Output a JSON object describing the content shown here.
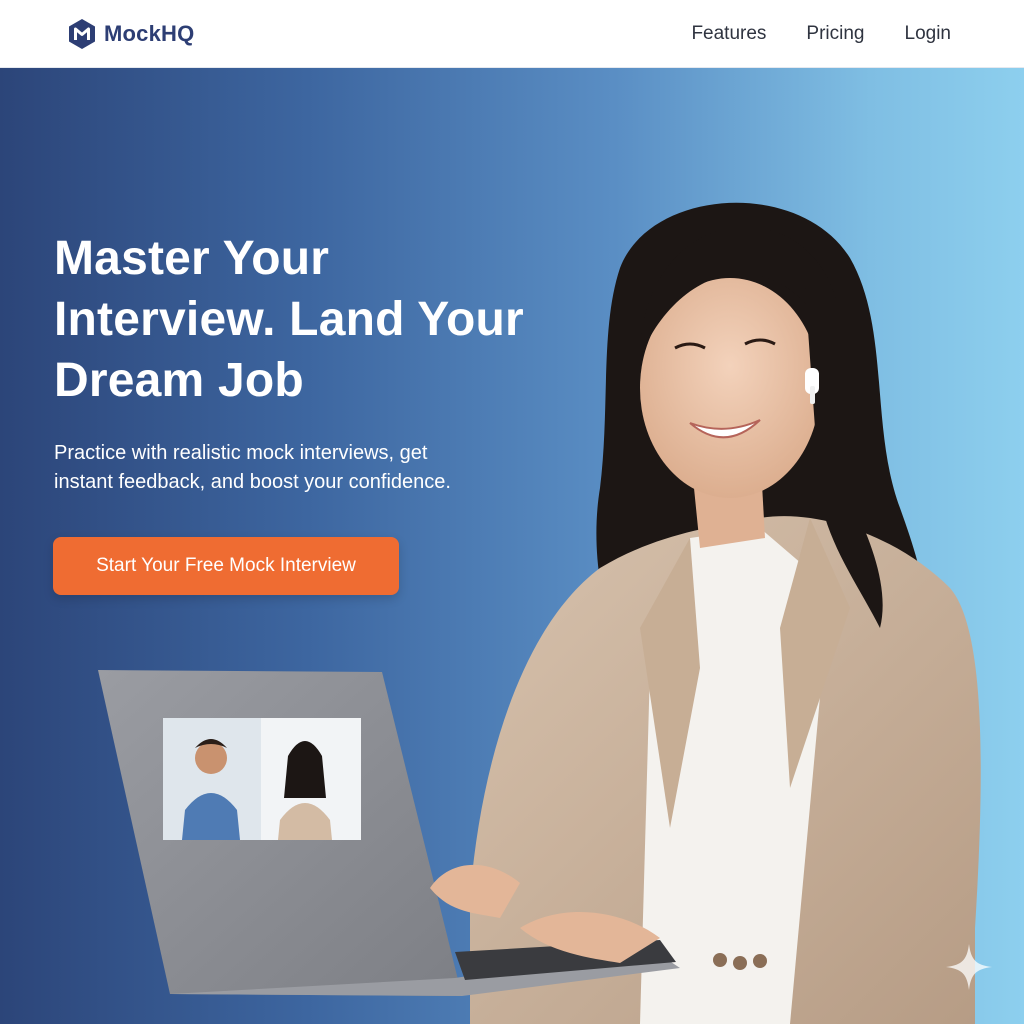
{
  "header": {
    "brand": "MockHQ",
    "nav": [
      "Features",
      "Pricing",
      "Login"
    ]
  },
  "hero": {
    "headline_lines": [
      "Master Your",
      "Interview. Land Your",
      "Dream Job"
    ],
    "subhead_lines": [
      "Practice with realistic mock interviews, get",
      "instant feedback, and boost your confidence."
    ],
    "cta_label": "Start Your Free Mock Interview"
  },
  "colors": {
    "brand": "#2d3e74",
    "cta": "#ef6c32",
    "hero_gradient_start": "#2c4579",
    "hero_gradient_end": "#8dcfee"
  },
  "icons": [
    "logo-icon",
    "sparkle-icon"
  ]
}
